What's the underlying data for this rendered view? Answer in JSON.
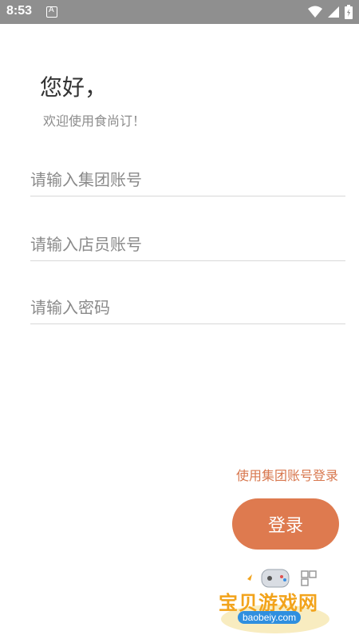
{
  "status_bar": {
    "time": "8:53",
    "a_badge": "A"
  },
  "greeting": "您好，",
  "subtitle": "欢迎使用食尚订！",
  "fields": {
    "group_account": {
      "placeholder": "请输入集团账号"
    },
    "staff_account": {
      "placeholder": "请输入店员账号"
    },
    "password": {
      "placeholder": "请输入密码"
    }
  },
  "alt_login_link": "使用集团账号登录",
  "login_button": "登录",
  "watermark": {
    "title": "宝贝游戏网",
    "url": "baobeiy.com"
  },
  "colors": {
    "accent": "#de7a4f",
    "status_bar": "#8f8f8f"
  }
}
